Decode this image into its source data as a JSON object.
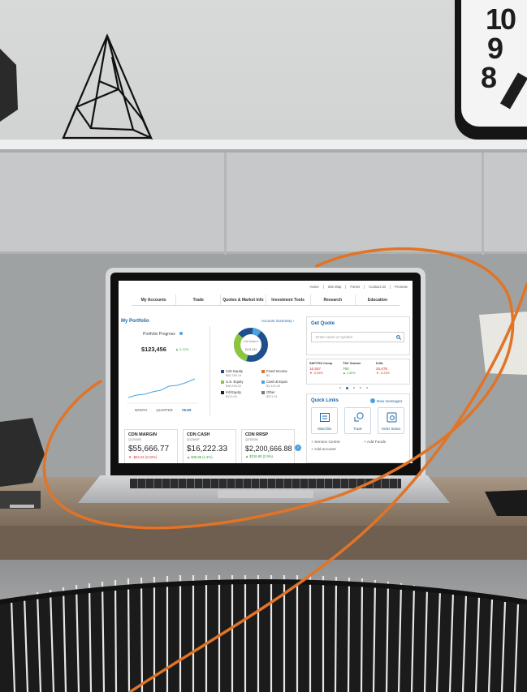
{
  "wall_clock": {
    "numbers": [
      "10",
      "9",
      "8"
    ],
    "color": "#1d1d1d"
  },
  "colors": {
    "accent_orange": "#e07427",
    "brand_blue": "#1b67a8",
    "wall": "#cfd0d0",
    "desk": "#8f7d69"
  },
  "dashboard": {
    "top_links": [
      "Home",
      "|",
      "Site Map",
      "|",
      "Forms",
      "|",
      "Contact Us",
      "|",
      "Promote"
    ],
    "nav": [
      "My Accounts",
      "Trade",
      "Quotes & Market Info",
      "Investment Tools",
      "Research",
      "Education"
    ],
    "portfolio": {
      "title": "My Portfolio",
      "summary_link": "Account Summary ›",
      "progress_label": "Portfolio Progress",
      "progress_value": "$123,456",
      "progress_change": "▲ 0.12%",
      "periods": [
        "MONTH",
        "QUARTER",
        "YEAR"
      ],
      "selected_period": "YEAR",
      "donut_label": "Total Balance",
      "donut_value": "$151,234",
      "allocation": [
        {
          "name": "Cdn Equity",
          "value": "$56,786.18",
          "color": "#1f4f8c",
          "share": 0.375
        },
        {
          "name": "Fixed Income",
          "value": "$0",
          "color": "#e07427",
          "share": 0.0
        },
        {
          "name": "U.S. Equity",
          "value": "$38,916.20",
          "color": "#8cc63f",
          "share": 0.257
        },
        {
          "name": "Cash & Equiv",
          "value": "$3,123.45",
          "color": "#4aa3df",
          "share": 0.021
        },
        {
          "name": "Intl Equity",
          "value": "$123.45",
          "color": "#222222",
          "share": 0.001
        },
        {
          "name": "Other",
          "value": "$321.01",
          "color": "#6d7c90",
          "share": 0.002
        }
      ]
    },
    "accounts": [
      {
        "name": "CDN MARGIN",
        "number": "Q12345E",
        "balance": "$55,666.77",
        "change": "▼ -$24.22 (0.22%)",
        "direction": "down"
      },
      {
        "name": "CDN CASH",
        "number": "Q12366F",
        "balance": "$16,222.33",
        "change": "▲ $38.88 (1.4%)",
        "direction": "up"
      },
      {
        "name": "CDN RRSP",
        "number": "Q23333K",
        "balance": "$2,200,666.88",
        "change": "▲ $318.88 (2.9%)",
        "direction": "up"
      }
    ],
    "quote": {
      "title": "Get Quote",
      "placeholder": "Enter name or symbol",
      "indices": [
        {
          "name": "S&P/TSX Comp",
          "value": "16,557",
          "change": "▼ -0.55%",
          "direction": "down"
        },
        {
          "name": "TSX Venture",
          "value": "780",
          "change": "▲ 1.59%",
          "direction": "up"
        },
        {
          "name": "DJIA",
          "value": "25,678",
          "change": "▼ -0.23%",
          "direction": "down"
        }
      ]
    },
    "quick_links": {
      "title": "Quick Links",
      "messages": "New messages",
      "tiles": [
        "Watchlist",
        "Trade",
        "Order Status"
      ],
      "links": [
        "Service Centre",
        "Add Funds",
        "Add account"
      ]
    }
  }
}
